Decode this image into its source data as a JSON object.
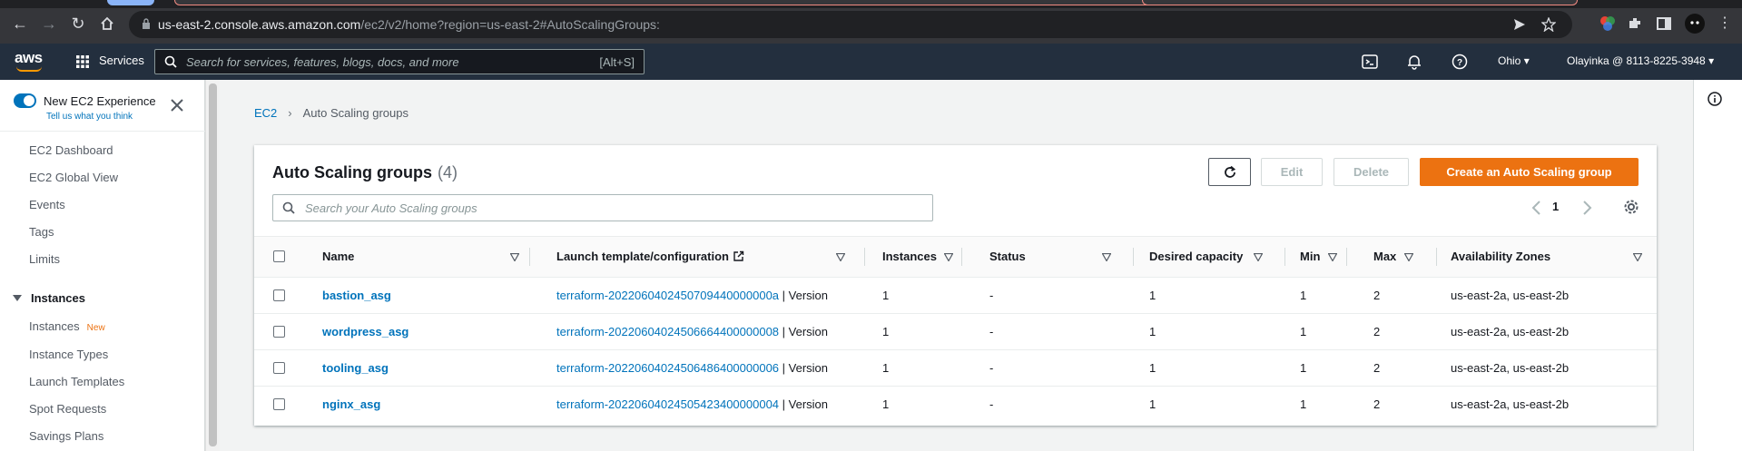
{
  "browser": {
    "url_host": "us-east-2.console.aws.amazon.com",
    "url_path": "/ec2/v2/home?region=us-east-2#AutoScalingGroups:"
  },
  "aws_nav": {
    "logo": "aws",
    "services_label": "Services",
    "search_placeholder": "Search for services, features, blogs, docs, and more",
    "search_shortcut": "[Alt+S]",
    "region": "Ohio",
    "account": "Olayinka @ 8113-8225-3948"
  },
  "sidebar": {
    "new_experience_label": "New EC2 Experience",
    "tell_us_link": "Tell us what you think",
    "items": [
      {
        "label": "EC2 Dashboard"
      },
      {
        "label": "EC2 Global View"
      },
      {
        "label": "Events"
      },
      {
        "label": "Tags"
      },
      {
        "label": "Limits"
      }
    ],
    "section_instances": "Instances",
    "instance_items": [
      {
        "label": "Instances",
        "badge": "New"
      },
      {
        "label": "Instance Types"
      },
      {
        "label": "Launch Templates"
      },
      {
        "label": "Spot Requests"
      },
      {
        "label": "Savings Plans"
      }
    ]
  },
  "breadcrumb": {
    "root": "EC2",
    "current": "Auto Scaling groups"
  },
  "panel": {
    "title": "Auto Scaling groups",
    "count": "(4)",
    "edit_label": "Edit",
    "delete_label": "Delete",
    "create_label": "Create an Auto Scaling group",
    "search_placeholder": "Search your Auto Scaling groups",
    "page_number": "1"
  },
  "table": {
    "columns": {
      "name": "Name",
      "template": "Launch template/configuration",
      "instances": "Instances",
      "status": "Status",
      "desired": "Desired capacity",
      "min": "Min",
      "max": "Max",
      "az": "Availability Zones"
    },
    "rows": [
      {
        "name": "bastion_asg",
        "template": "terraform-2022060402450709440000000a",
        "version": " | Version",
        "instances": "1",
        "status": "-",
        "desired": "1",
        "min": "1",
        "max": "2",
        "az": "us-east-2a, us-east-2b"
      },
      {
        "name": "wordpress_asg",
        "template": "terraform-20220604024506664400000008",
        "version": " | Version",
        "instances": "1",
        "status": "-",
        "desired": "1",
        "min": "1",
        "max": "2",
        "az": "us-east-2a, us-east-2b"
      },
      {
        "name": "tooling_asg",
        "template": "terraform-20220604024506486400000006",
        "version": " | Version",
        "instances": "1",
        "status": "-",
        "desired": "1",
        "min": "1",
        "max": "2",
        "az": "us-east-2a, us-east-2b"
      },
      {
        "name": "nginx_asg",
        "template": "terraform-20220604024505423400000004",
        "version": " | Version",
        "instances": "1",
        "status": "-",
        "desired": "1",
        "min": "1",
        "max": "2",
        "az": "us-east-2a, us-east-2b"
      }
    ]
  },
  "colors": {
    "aws_nav_bg": "#232f3e",
    "link_blue": "#0073bb",
    "primary_orange": "#ec7211",
    "page_bg": "#f2f3f3"
  }
}
